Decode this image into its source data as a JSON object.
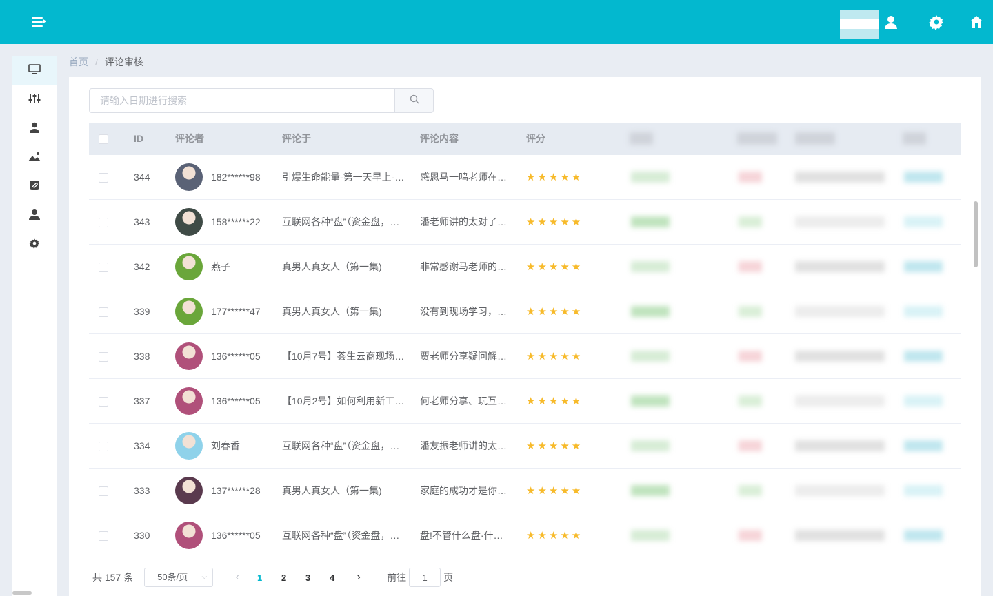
{
  "breadcrumb": {
    "home": "首页",
    "separator": "/",
    "current": "评论审核"
  },
  "search": {
    "placeholder": "请输入日期进行搜索",
    "value": ""
  },
  "table": {
    "columns": {
      "id": "ID",
      "reviewer": "评论者",
      "target": "评论于",
      "content": "评论内容",
      "rating": "评分"
    },
    "rows": [
      {
        "id": "344",
        "reviewer": "182******98",
        "target": "引爆生命能量-第一天早上-…",
        "content": "感恩马一鸣老师在…",
        "rating": "★★★★★",
        "avatar_color": "#5a6276"
      },
      {
        "id": "343",
        "reviewer": "158******22",
        "target": "互联网各种“盘”（资金盘，…",
        "content": "潘老师讲的太对了…",
        "rating": "★★★★★",
        "avatar_color": "#3f4b46"
      },
      {
        "id": "342",
        "reviewer": "燕子",
        "target": "真男人真女人（第一集)",
        "content": "非常感谢马老师的…",
        "rating": "★★★★★",
        "avatar_color": "#6aa63a"
      },
      {
        "id": "339",
        "reviewer": "177******47",
        "target": "真男人真女人（第一集)",
        "content": "没有到现场学习，…",
        "rating": "★★★★★",
        "avatar_color": "#6aa63a"
      },
      {
        "id": "338",
        "reviewer": "136******05",
        "target": "【10月7号】荟生云商现场…",
        "content": "贾老师分享疑问解…",
        "rating": "★★★★★",
        "avatar_color": "#b0507a"
      },
      {
        "id": "337",
        "reviewer": "136******05",
        "target": "【10月2号】如何利用新工…",
        "content": "何老师分享、玩互…",
        "rating": "★★★★★",
        "avatar_color": "#b0507a"
      },
      {
        "id": "334",
        "reviewer": "刘春香",
        "target": "互联网各种“盘”（资金盘，…",
        "content": "潘友振老师讲的太…",
        "rating": "★★★★★",
        "avatar_color": "#8fd2ea"
      },
      {
        "id": "333",
        "reviewer": "137******28",
        "target": "真男人真女人（第一集)",
        "content": "家庭的成功才是你…",
        "rating": "★★★★★",
        "avatar_color": "#5a3a4e"
      },
      {
        "id": "330",
        "reviewer": "136******05",
        "target": "互联网各种“盘”（资金盘，…",
        "content": "盘!不管什么盘·什…",
        "rating": "★★★★★",
        "avatar_color": "#b0507a"
      }
    ]
  },
  "pagination": {
    "total": "共 157 条",
    "page_size": "50条/页",
    "pages": [
      "1",
      "2",
      "3",
      "4"
    ],
    "current_page": "1",
    "goto_prefix": "前往",
    "goto_value": "1",
    "goto_suffix": "页"
  },
  "colors": {
    "topbar": "#03b8cf",
    "star": "#f7ba2a",
    "active_page": "#03b8cf"
  },
  "icons": {
    "topbar": [
      "menu-toggle-icon",
      "user-icon",
      "gear-icon",
      "home-icon"
    ],
    "sidebar": [
      "monitor-icon",
      "sliders-icon",
      "user-icon",
      "image-icon",
      "attachment-icon",
      "user-icon",
      "gear-icon"
    ]
  }
}
